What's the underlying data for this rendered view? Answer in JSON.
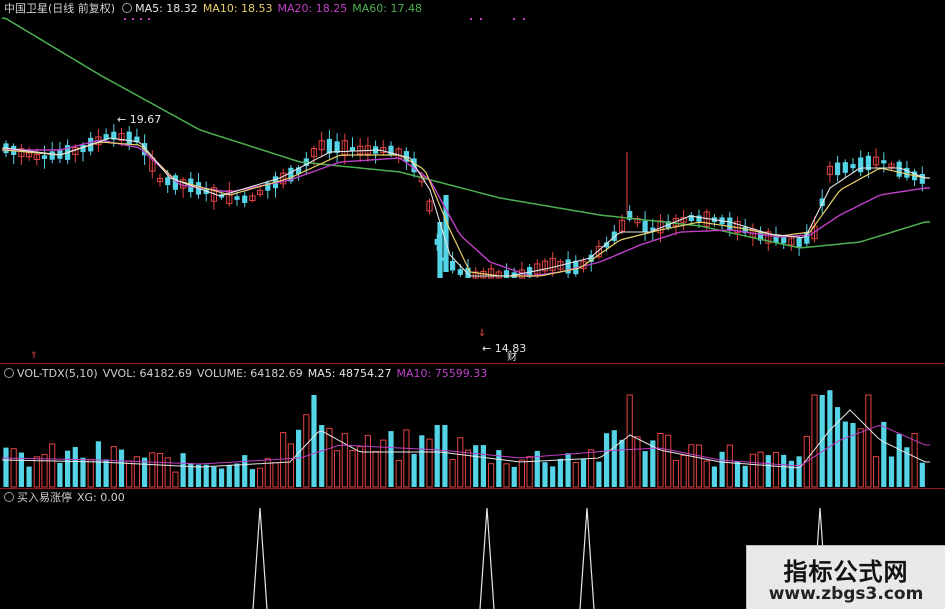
{
  "header": {
    "title": "中国卫星(日线 前复权)",
    "ma5": "MA5: 18.32",
    "ma10": "MA10: 18.53",
    "ma20": "MA20: 18.25",
    "ma60": "MA60: 17.48"
  },
  "vol_header": {
    "name": "VOL-TDX(5,10)",
    "vvol": "VVOL: 64182.69",
    "volume": "VOLUME: 64182.69",
    "ma5": "MA5: 48754.27",
    "ma10": "MA10: 75599.33"
  },
  "xg_header": {
    "name": "买入易涨停",
    "xg": "XG: 0.00"
  },
  "labels": {
    "high_price": "19.67",
    "low_price": "14.83",
    "finance_mark": "财"
  },
  "watermark": {
    "line1": "指标公式网",
    "line2": "www.zbgs3.com"
  },
  "colors": {
    "up": "#e24343",
    "down": "#54d4e6",
    "ma5": "#e6e6e6",
    "ma10": "#e8d06a",
    "ma20": "#c040c8",
    "ma60": "#4caf50",
    "separator": "#8b1a1a"
  },
  "chart_data": [
    {
      "type": "candlestick",
      "title": "中国卫星(日线 前复权)",
      "y_range": [
        14.83,
        19.67
      ],
      "series": [
        "MA5",
        "MA10",
        "MA20",
        "MA60"
      ]
    },
    {
      "type": "bar",
      "title": "VOL-TDX(5,10)",
      "series": [
        "VOLUME",
        "MA5",
        "MA10"
      ]
    },
    {
      "type": "line",
      "title": "买入易涨停",
      "series": [
        "XG"
      ],
      "signal_spikes": 4
    }
  ]
}
